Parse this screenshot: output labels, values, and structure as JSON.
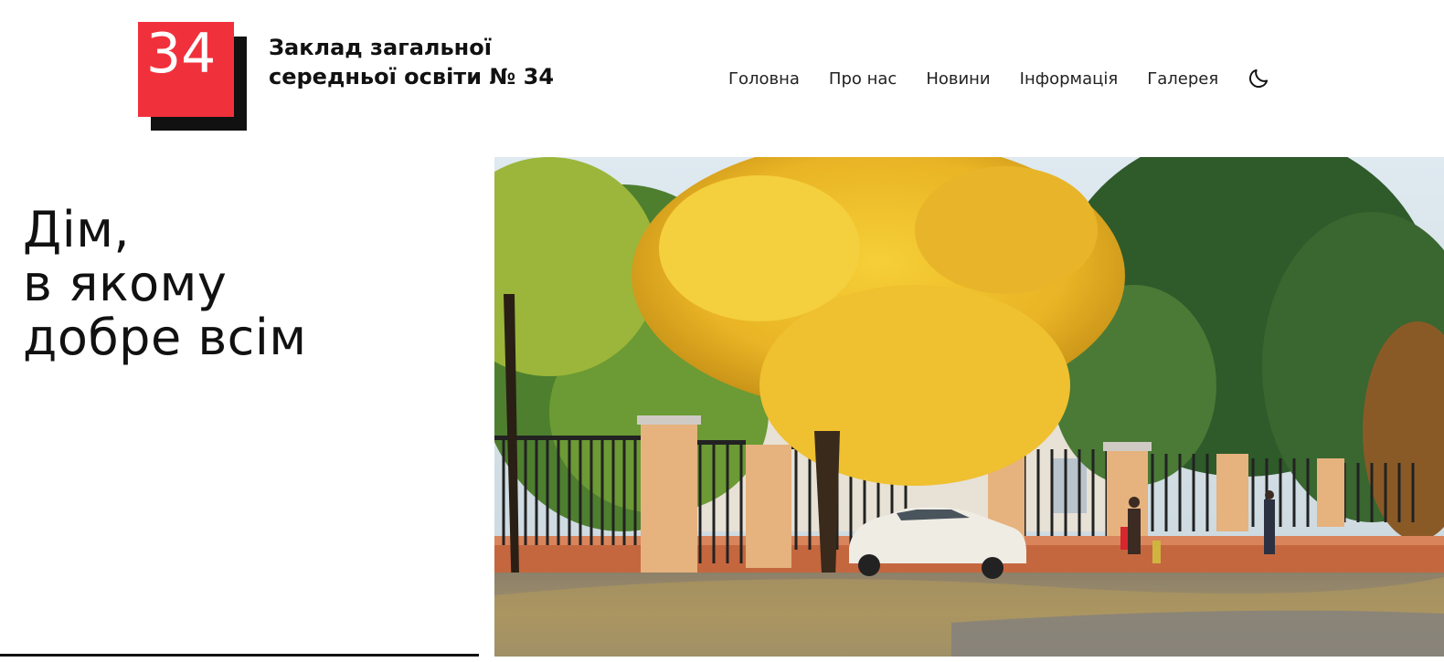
{
  "site": {
    "logo_number": "34",
    "title_line1": "Заклад загальної",
    "title_line2": "середньої освіти № 34"
  },
  "nav": {
    "items": [
      {
        "label": "Головна"
      },
      {
        "label": "Про нас"
      },
      {
        "label": "Новини"
      },
      {
        "label": "Інформація"
      },
      {
        "label": "Галерея"
      }
    ],
    "theme_toggle_icon": "moon-icon"
  },
  "hero": {
    "line1": "Дім,",
    "line2": "в якому",
    "line3": "добре всім",
    "image": "school-building-autumn-photo"
  },
  "colors": {
    "brand_red": "#f0313c",
    "text": "#111111",
    "background": "#ffffff"
  }
}
